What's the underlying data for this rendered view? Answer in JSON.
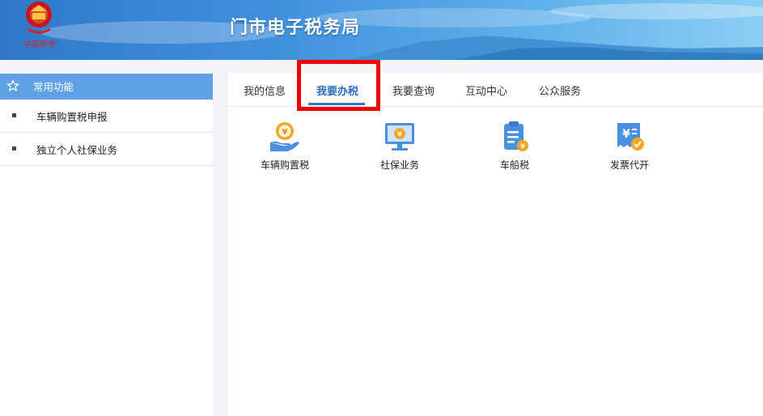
{
  "header": {
    "title": "门市电子税务局",
    "emblem_text": "中国税务"
  },
  "sidebar": {
    "title": "常用功能",
    "items": [
      {
        "label": "车辆购置税申报"
      },
      {
        "label": "独立个人社保业务"
      }
    ]
  },
  "tabs": [
    {
      "label": "我的信息"
    },
    {
      "label": "我要办税",
      "active": true
    },
    {
      "label": "我要查询"
    },
    {
      "label": "互动中心"
    },
    {
      "label": "公众服务"
    }
  ],
  "services": [
    {
      "label": "车辆购置税",
      "icon": "coin-hand-icon"
    },
    {
      "label": "社保业务",
      "icon": "monitor-coin-icon"
    },
    {
      "label": "车船税",
      "icon": "clipboard-coin-icon"
    },
    {
      "label": "发票代开",
      "icon": "invoice-check-icon"
    }
  ],
  "colors": {
    "accent": "#2a7bd0",
    "sidebar_header": "#5ea1e6",
    "highlight": "#ee0000",
    "icon_orange": "#f5a623",
    "icon_blue": "#4a90e2"
  }
}
